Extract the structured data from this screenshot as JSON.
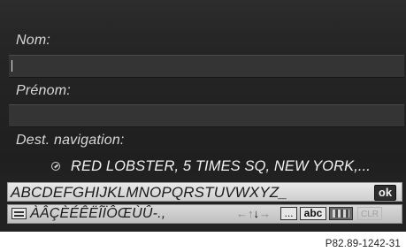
{
  "form": {
    "last_name_label": "Nom:",
    "last_name_value": "",
    "first_name_label": "Prénom:",
    "first_name_value": "",
    "destination_label": "Dest. navigation:",
    "destination_value": "RED LOBSTER, 5 TIMES SQ, NEW YORK,...",
    "destination_icon": "navigation-flag-icon"
  },
  "keyboard": {
    "letters": "ABCDEFGHIJKLMNOPQRSTUVWXYZ_",
    "ok_label": "ok",
    "mode_icon": "character-set-switch-icon",
    "accent_chars": "ÀÂÇÈÉÊËÎÏÔŒÙÛ-.,",
    "arrow_left": "←",
    "arrow_up": "↑",
    "arrow_down": "↓",
    "arrow_right": "→",
    "space_label": "...",
    "abc_label": "abc",
    "language_icon": "keyboard-language-flag-icon",
    "clear_label": "CLR"
  },
  "figure_reference": "P82.89-1242-31"
}
